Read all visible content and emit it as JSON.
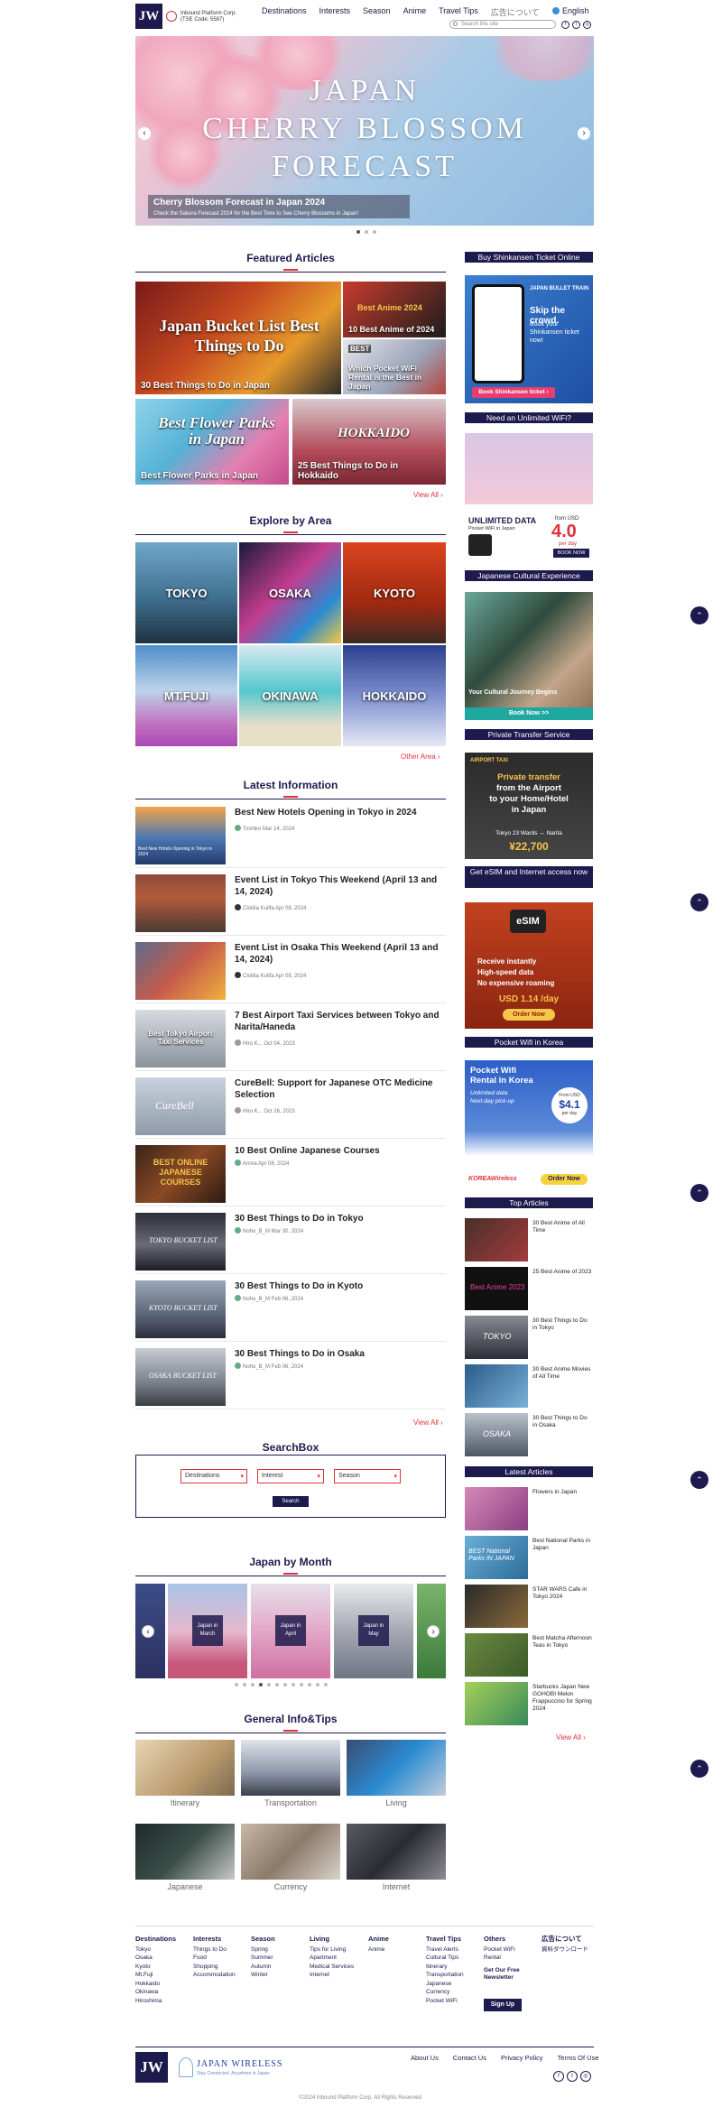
{
  "header": {
    "logo_text": "JW",
    "company": "Inbound Platform Corp. (TSE Code: 5587)",
    "nav": [
      "Destinations",
      "Interests",
      "Season",
      "Anime",
      "Travel Tips",
      "広告について"
    ],
    "language": "English",
    "search_placeholder": "Search this site"
  },
  "hero": {
    "title_lines": [
      "JAPAN",
      "CHERRY BLOSSOM",
      "FORECAST"
    ],
    "caption_title": "Cherry Blossom Forecast in Japan 2024",
    "caption_sub": "Check the Sakura Forecast 2024 for the Best Time to See Cherry Blossoms in Japan!"
  },
  "featured": {
    "heading": "Featured Articles",
    "items": [
      {
        "overlay": "Japan Bucket List Best Things to Do",
        "label": "30 Best Things to Do in Japan"
      },
      {
        "overlay": "Best Anime 2024",
        "label": "10 Best Anime of 2024"
      },
      {
        "overlay": "BEST",
        "label": "Which Pocket WiFi Rental is the Best in Japan"
      },
      {
        "overlay": "Best Flower Parks in Japan",
        "label": "Best Flower Parks in Japan"
      },
      {
        "overlay": "HOKKAIDO",
        "label": "25 Best Things to Do in Hokkaido"
      }
    ],
    "view_all": "View All ›"
  },
  "explore": {
    "heading": "Explore by Area",
    "areas": [
      "TOKYO",
      "OSAKA",
      "KYOTO",
      "MT.FUJI",
      "OKINAWA",
      "HOKKAIDO"
    ],
    "other": "Other Area ›"
  },
  "latest": {
    "heading": "Latest Information",
    "items": [
      {
        "thumb": "Best New Hotels Opening in Tokyo in 2024",
        "title": "Best New Hotels Opening in Tokyo in 2024",
        "author": "Toshiko Mar 14, 2024"
      },
      {
        "thumb": "",
        "title": "Event List in Tokyo This Weekend (April 13 and 14, 2024)",
        "author": "Clotilia Kuilfa Apr 08, 2024"
      },
      {
        "thumb": "",
        "title": "Event List in Osaka This Weekend (April 13 and 14, 2024)",
        "author": "Clotilia Kuilfa Apr 08, 2024"
      },
      {
        "thumb": "Best Tokyo Airport Taxi Services",
        "title": "7 Best Airport Taxi Services between Tokyo and Narita/Haneda",
        "author": "Hiro K... Oct 04, 2023"
      },
      {
        "thumb": "CureBell",
        "title": "CureBell: Support for Japanese OTC Medicine Selection",
        "author": "Hiro K... Oct 26, 2023"
      },
      {
        "thumb": "BEST ONLINE JAPANESE COURSES",
        "title": "10 Best Online Japanese Courses",
        "author": "Anma Apr 08, 2024"
      },
      {
        "thumb": "TOKYO BUCKET LIST",
        "title": "30 Best Things to Do in Tokyo",
        "author": "Noho_B_M Mar 30, 2024"
      },
      {
        "thumb": "KYOTO BUCKET LIST",
        "title": "30 Best Things to Do in Kyoto",
        "author": "Noho_B_M Feb 06, 2024"
      },
      {
        "thumb": "OSAKA BUCKET LIST",
        "title": "30 Best Things to Do in Osaka",
        "author": "Noho_B_M Feb 06, 2024"
      }
    ],
    "view_all": "View All ›"
  },
  "searchbox": {
    "heading": "SearchBox",
    "selects": [
      "Destinations",
      "Interest",
      "Season"
    ],
    "button": "Search"
  },
  "month": {
    "heading": "Japan by Month",
    "cards": [
      "Japan in March",
      "Japan in April",
      "Japan in May"
    ]
  },
  "general": {
    "heading": "General Info&Tips",
    "items": [
      "Itinerary",
      "Transportation",
      "Living",
      "Japanese",
      "Currency",
      "Internet"
    ]
  },
  "sidebar": {
    "heads": [
      "Buy Shinkansen Ticket Online",
      "Need an Unlimited WiFi?",
      "Japanese Cultural Experience",
      "Private Transfer Service",
      "Get eSIM and Internet access now",
      "Pocket Wifi in Korea"
    ],
    "ad1": {
      "brand": "JAPAN BULLET TRAIN",
      "lines": [
        "Skip the crowd.",
        "Book your Shinkansen ticket now!"
      ],
      "button": "Book Shinkansen ticket ›"
    },
    "ad2": {
      "title": "UNLIMITED DATA",
      "sub": "Pocket WiFi in Japan",
      "from": "from USD",
      "price": "4.0",
      "per": "per day",
      "button": "BOOK NOW"
    },
    "ad3": {
      "title": "Your Cultural Journey Begins",
      "button": "Book Now >>"
    },
    "ad4": {
      "tag": "AIRPORT TAXI",
      "lines": [
        "Private transfer",
        "from the Airport",
        "to your Home/Hotel",
        "in Japan"
      ],
      "route": "Tokyo 23 Wards ↔ Narita",
      "price": "¥22,700"
    },
    "ad5": {
      "tag": "eSIM",
      "lines": [
        "Receive instantly",
        "High-speed data",
        "No expensive roaming"
      ],
      "price": "USD 1.14 /day",
      "button": "Order Now"
    },
    "ad6": {
      "title": "Pocket Wifi Rental in Korea",
      "lines": [
        "Unlimited data",
        "Next-day pick-up"
      ],
      "from": "From USD",
      "price": "$4.1",
      "per": "per day",
      "brand": "KOREAWireless",
      "button": "Order Now"
    },
    "top_head": "Top Articles",
    "top": [
      {
        "thumb": "",
        "title": "30 Best Anime of All Time"
      },
      {
        "thumb": "Best Anime 2023",
        "title": "25 Best Anime of 2023"
      },
      {
        "thumb": "TOKYO",
        "title": "30 Best Things to Do in Tokyo"
      },
      {
        "thumb": "",
        "title": "30 Best Anime Movies of All Time"
      },
      {
        "thumb": "OSAKA",
        "title": "30 Best Things to Do in Osaka"
      }
    ],
    "latest_head": "Latest Articles",
    "latest": [
      {
        "thumb": "",
        "title": "Flowers in Japan"
      },
      {
        "thumb": "BEST National Parks IN JAPAN",
        "title": "Best National Parks in Japan"
      },
      {
        "thumb": "",
        "title": "STAR WARS Cafe in Tokyo 2024"
      },
      {
        "thumb": "",
        "title": "Best Matcha Afternoon Teas in Tokyo"
      },
      {
        "thumb": "",
        "title": "Starbucks Japan New GOHOBI Melon Frappuccino for Spring 2024"
      }
    ],
    "view_all": "View All ›"
  },
  "footer": {
    "cols": [
      {
        "head": "Destinations",
        "items": [
          "Tokyo",
          "Osaka",
          "Kyoto",
          "Mt.Fuji",
          "Hokkaido",
          "Okinawa",
          "Hiroshima"
        ]
      },
      {
        "head": "Interests",
        "items": [
          "Things to Do",
          "Food",
          "Shopping",
          "Accommodation"
        ]
      },
      {
        "head": "Season",
        "items": [
          "Spring",
          "Summer",
          "Autumn",
          "Winter"
        ]
      },
      {
        "head": "Living",
        "items": [
          "Tips for Living",
          "Apartment",
          "Medical Services",
          "Internet"
        ]
      },
      {
        "head": "Anime",
        "items": [
          "Anime"
        ]
      },
      {
        "head": "Travel Tips",
        "items": [
          "Travel Alerts",
          "Cultural Tips",
          "Itinerary",
          "Transportation",
          "Japanese",
          "Currency",
          "Pocket WiFi"
        ]
      },
      {
        "head": "Others",
        "items": [
          "Pocket WiFi",
          "Rental"
        ]
      },
      {
        "head": "広告について",
        "items": [
          "資料ダウンロード"
        ]
      }
    ],
    "newsletter": "Get Our Free Newsletter",
    "signup": "Sign Up",
    "brand": "JAPAN WIRELESS",
    "brand_sub": "Stay Connected, Anywhere in Japan",
    "links": [
      "About Us",
      "Contact Us",
      "Privacy Policy",
      "Terms Of Use"
    ],
    "copyright": "©2024 Inbound Platform Corp. All Rights Reserved."
  },
  "colors": {
    "navy": "#1d1a4e",
    "accent": "#e0313b"
  }
}
